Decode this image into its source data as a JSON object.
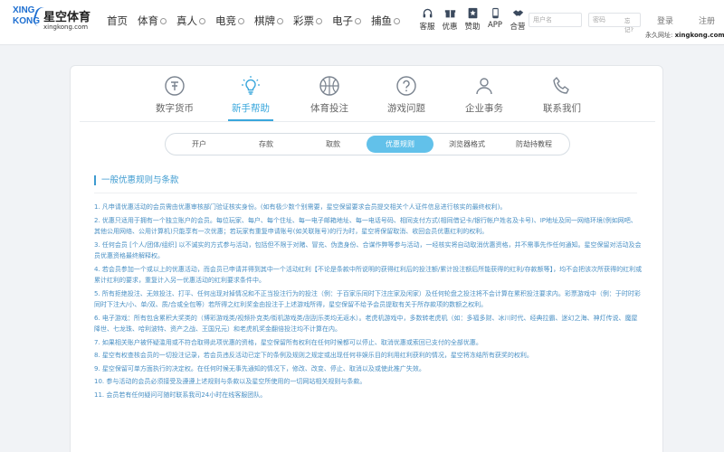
{
  "brand": {
    "logo_line1": "XING",
    "logo_line2": "KONG",
    "name_cn": "星空体育",
    "domain": "xingkong.com"
  },
  "nav": [
    {
      "label": "首页",
      "dropdown": false
    },
    {
      "label": "体育",
      "dropdown": true
    },
    {
      "label": "真人",
      "dropdown": true
    },
    {
      "label": "电竞",
      "dropdown": true
    },
    {
      "label": "棋牌",
      "dropdown": true
    },
    {
      "label": "彩票",
      "dropdown": true
    },
    {
      "label": "电子",
      "dropdown": true
    },
    {
      "label": "捕鱼",
      "dropdown": true
    }
  ],
  "utility": [
    {
      "label": "客服",
      "icon": "headset-icon"
    },
    {
      "label": "优惠",
      "icon": "gift-icon"
    },
    {
      "label": "赞助",
      "icon": "star-badge-icon"
    },
    {
      "label": "APP",
      "icon": "phone-icon"
    },
    {
      "label": "合营",
      "icon": "handshake-icon"
    }
  ],
  "login": {
    "username_placeholder": "用户名",
    "password_placeholder": "密码",
    "forgot": "忘记?",
    "login_button": "登录",
    "register_button": "注册",
    "permanent_label": "永久网址:",
    "permanent_url": "xingkong.com"
  },
  "categories": [
    {
      "label": "数字货币",
      "icon": "currency-icon",
      "active": false
    },
    {
      "label": "新手帮助",
      "icon": "lightbulb-icon",
      "active": true
    },
    {
      "label": "体育投注",
      "icon": "ball-icon",
      "active": false
    },
    {
      "label": "游戏问题",
      "icon": "question-icon",
      "active": false
    },
    {
      "label": "企业事务",
      "icon": "briefcase-icon",
      "active": false
    },
    {
      "label": "联系我们",
      "icon": "phone-call-icon",
      "active": false
    }
  ],
  "subtabs": [
    {
      "label": "开户",
      "active": false
    },
    {
      "label": "存款",
      "active": false
    },
    {
      "label": "取款",
      "active": false
    },
    {
      "label": "优惠规则",
      "active": true
    },
    {
      "label": "浏览器格式",
      "active": false
    },
    {
      "label": "防劫持教程",
      "active": false
    }
  ],
  "section_title": "一般优惠规则与条款",
  "rules": [
    "1. 凡申请优惠活动的会员需由优惠审核部门验证核实身份。(如有极少数个别需要，星空保留要求会员提交相关个人证件信息进行核实的最终权利)。",
    "2. 优惠只适用于拥有一个独立账户的会员。每位玩家、每户、每个住址、每一电子邮箱地址、每一电话号码、相同支付方式(相同借记卡/银行帐户姓名及卡号)、IP地址及同一网络环境(例如网吧、其他公用网络、公用计算机)只能享有一次优惠；若玩家有重复申请账号(如关联账号)的行为时，星空将保留取消、收回会员优惠红利的权利。",
    "3. 任何会员 [个人/团体/组织] 以不诚实的方式参与活动，包括但不限于对赌、冒充、伪造身份、合谋作弊等参与活动，一经核实将自动取消优惠资格，并不需事先作任何通知。星空保留对活动及会员优惠资格最终解释权。",
    "4. 若会员参加一个或以上的优惠活动，而会员已申请并得到其中一个活动红利【不论是条款中所说明的获得红利后的投注额/累计投注额后所能获得的红利/存款额等】，均不会把该次所获得的红利或累计红利的要求，重复计入另一优惠活动的红利要求条件中。",
    "5. 所有拒绝投注、无效投注、打平、任何出现对掉情况和不正当投注行为的投注（例：于百家乐同时下注庄家及闲家）及任何轮盘之投注将不会计算在累积投注要求内。彩票游戏中（例：于时时彩同时下注大/小、单/双、质/合或全包等）若所得之红利奖金由投注于上述游戏所得，星空保留不给予会员提取有关于所存款项的数额之权利。",
    "6. 电子游戏：所有包含累积大奖类的（博彩游戏类/视频扑克类/街机游戏类/刮刮乐类均无返水）。老虎机游戏中，多数转老虎机（如：多福多财、冰川时代、经典拉霸、迷幻之海、神灯传说、魔屋降世、七龙珠、哈利波特、资产之战、王国兄元）和老虎机奖金翻倍投注均不计算在内。",
    "7. 如果相关账户被怀疑滥用或不符合取得此项优惠的资格，星空保留所有权利在任何时候都可以停止、取消优惠或索回已支付的全部优惠。",
    "8. 星空有权查核会员的一切投注记录，若会员违反活动已定下的条例及规则之规定或出现任何非娱乐目的利用红利获利的情况，星空将冻结所有获奖的权利。",
    "9. 星空保留可单方面执行的决定权。在任何时候无事先通知的情况下，修改、改变、停止、取消以及或使此推广失效。",
    "10. 参与活动的会员必须接受及遵遵上述规则与条款以及星空所使用的一切网站相关规则与条款。",
    "11. 会员若有任何疑问可随时联系我司24小时在线客服团队。"
  ],
  "colors": {
    "accent": "#3aa7dc",
    "active_pill": "#62c1ea",
    "rule_text": "#4a90c4",
    "brand_blue": "#1e6fd1"
  }
}
